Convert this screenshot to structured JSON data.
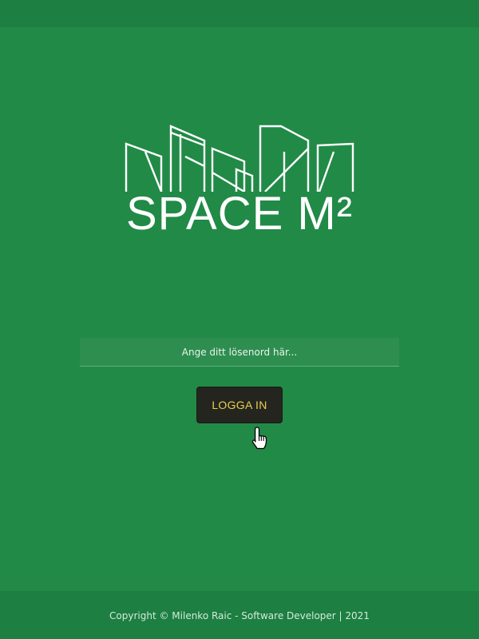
{
  "colors": {
    "background": "#218a47",
    "button_background": "#24251f",
    "button_text": "#e8cf52",
    "logo": "#ffffff"
  },
  "logo": {
    "icon": "city-skyline-icon",
    "wordmark": "SPACE M²"
  },
  "login": {
    "password_placeholder": "Ange ditt lösenord här...",
    "password_value": "",
    "button_label": "LOGGA IN"
  },
  "cursor": {
    "icon": "hand-pointer-icon"
  },
  "footer": {
    "copyright": "Copyright ©  Milenko Raic - Software Developer | 2021"
  }
}
